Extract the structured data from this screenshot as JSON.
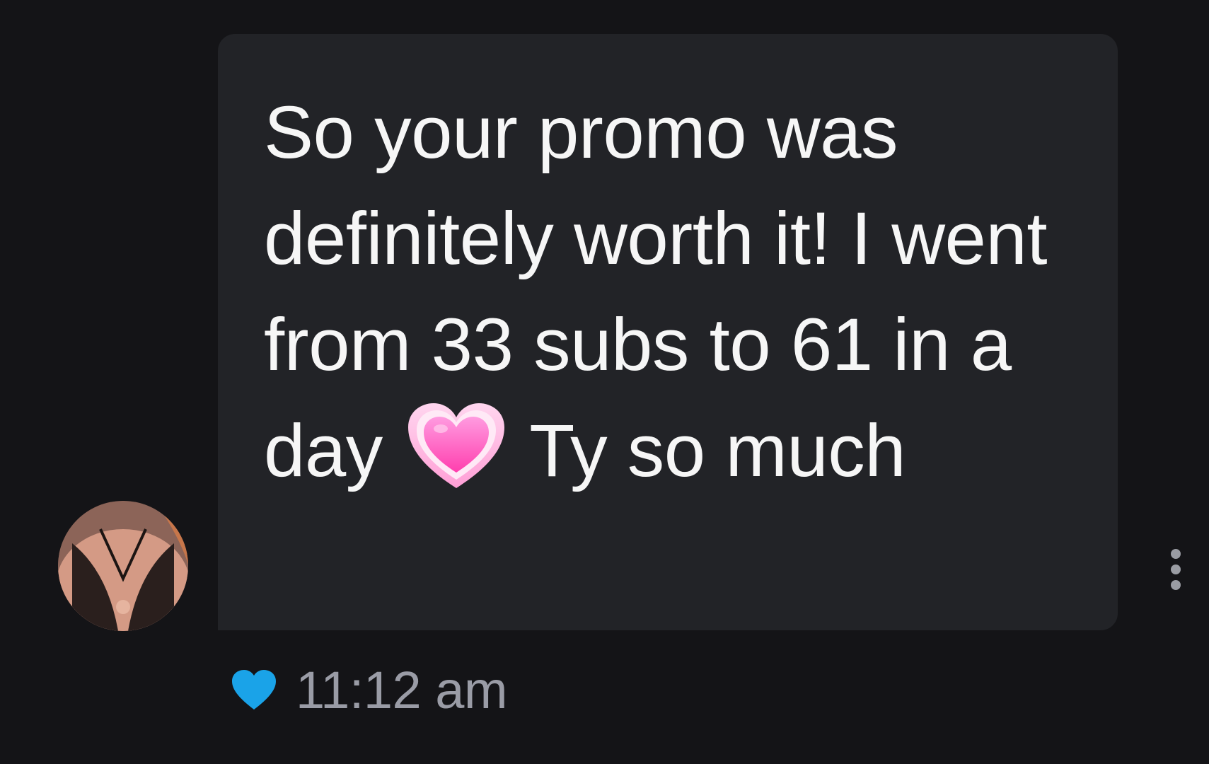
{
  "message": {
    "text_before_emoji": "So your promo was definitely worth it! I went from 33 subs to 61 in a day",
    "emoji": "growing-heart-emoji",
    "text_after_emoji": "Ty so much",
    "timestamp": "11:12 am",
    "liked": true
  },
  "colors": {
    "background": "#141417",
    "bubble": "#222327",
    "text": "#f6f6f6",
    "timestamp": "#9a9ca6",
    "like_heart": "#1aa3e8",
    "emoji_heart": "#ff4fb8"
  }
}
